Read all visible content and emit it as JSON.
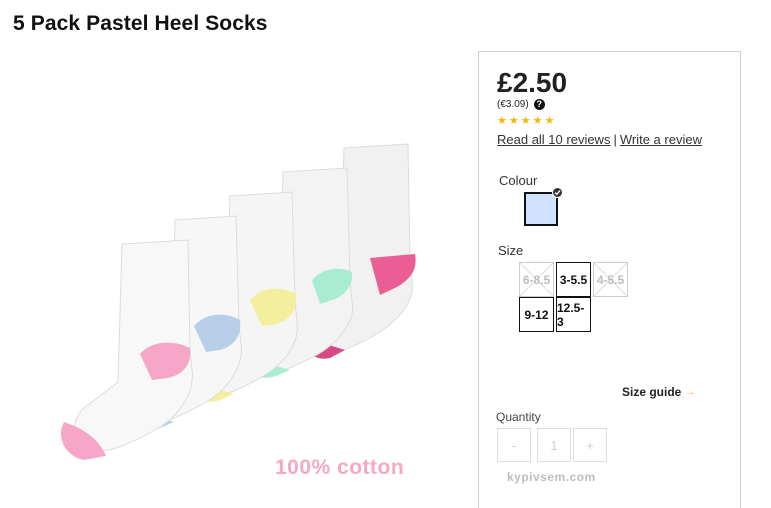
{
  "product": {
    "title": "5 Pack Pastel Heel Socks",
    "image_caption": "100% cotton"
  },
  "price": {
    "main": "£2.50",
    "euro": "(€3.09)",
    "help_icon": "question-circle-icon"
  },
  "rating": {
    "stars": 5,
    "reviews_link": "Read all 10 reviews",
    "separator": "|",
    "write_link": "Write a review"
  },
  "colour": {
    "label": "Colour",
    "swatch_color": "#cfe2ff",
    "selected_icon": "check-icon"
  },
  "size": {
    "label": "Size",
    "options": [
      {
        "label": "6-8.5",
        "available": false
      },
      {
        "label": "3-5.5",
        "available": true
      },
      {
        "label": "4-5.5",
        "available": false
      },
      {
        "label": "9-12",
        "available": true
      },
      {
        "label": "12.5-3",
        "available": true
      }
    ],
    "guide_label": "Size guide",
    "guide_icon": "arrow-right-icon"
  },
  "quantity": {
    "label": "Quantity",
    "decrement": "-",
    "value": "1",
    "increment": "+"
  },
  "watermark": "kypivsem.com",
  "colors": {
    "star": "#f2b705",
    "caption": "#f4a8c6",
    "heel_colors": [
      "#f6a6c6",
      "#b8cfea",
      "#f3ef9c",
      "#a8ecd2",
      "#ea5e93"
    ]
  }
}
